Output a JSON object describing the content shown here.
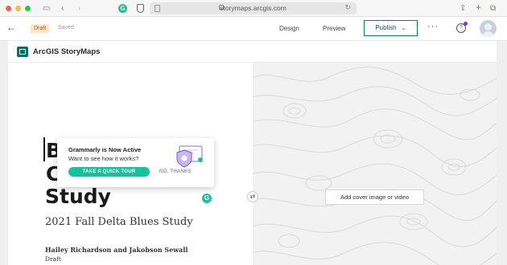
{
  "browser": {
    "url": "storymaps.arcgis.com"
  },
  "header": {
    "status_badge": "Draft",
    "save_state": "Saved",
    "design_label": "Design",
    "preview_label": "Preview",
    "publish_label": "Publish",
    "more_label": "···"
  },
  "brand": {
    "name": "ArcGIS StoryMaps"
  },
  "story": {
    "title_line1": "B",
    "title_line2": "C",
    "title_line3": "Study",
    "subtitle": "2021 Fall Delta Blues Study",
    "authors": "Hailey Richardson and Jakobson Sewall",
    "status": "Draft"
  },
  "cover": {
    "add_media_label": "Add cover image or video"
  },
  "grammarly": {
    "title": "Grammarly is Now Active",
    "text": "Want to see how it works?",
    "tour_label": "TAKE A QUICK TOUR",
    "dismiss_label": "NO, THANKS",
    "badge": "G"
  },
  "colors": {
    "brand": "#0b6e61",
    "grammarly": "#15c39a",
    "draft_badge_bg": "#fde6cf"
  }
}
